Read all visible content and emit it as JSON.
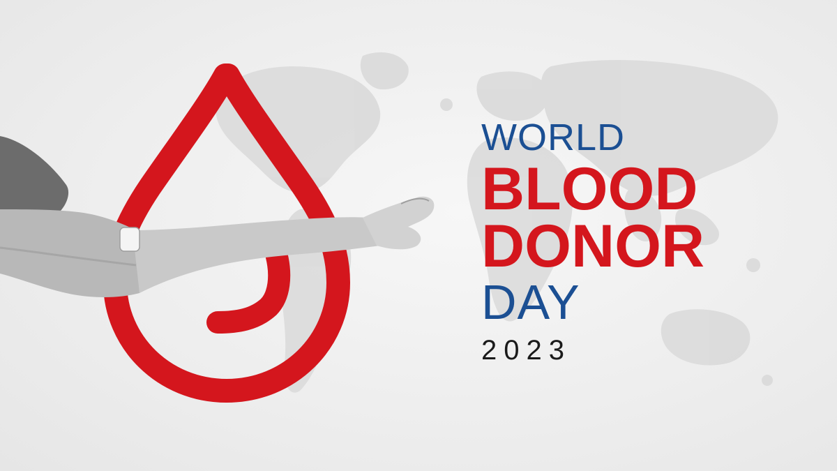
{
  "banner": {
    "line_world": "WORLD",
    "line_blood": "BLOOD",
    "line_donor": "DONOR",
    "line_day": "DAY",
    "line_year": "2023"
  },
  "colors": {
    "blue": "#1b4f93",
    "red": "#d4161d",
    "black": "#1a1a1a",
    "background": "#efefef",
    "map": "#d6d6d6"
  },
  "icons": {
    "blood_drop": "blood-drop-logo",
    "arm": "outstretched-arm",
    "map": "world-map"
  }
}
